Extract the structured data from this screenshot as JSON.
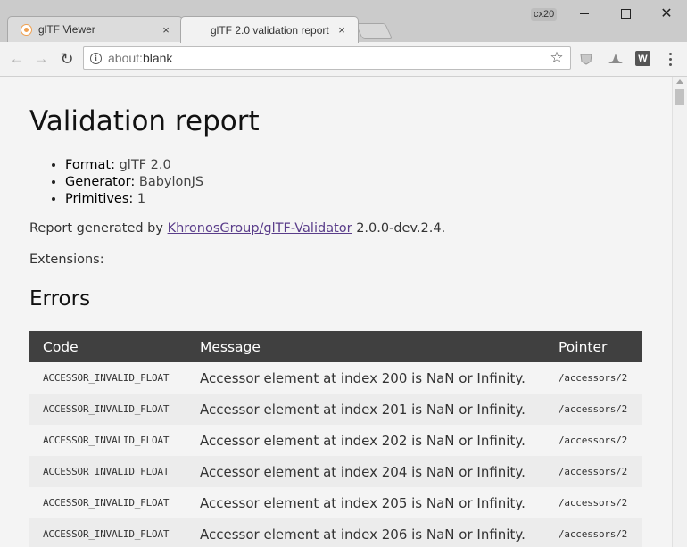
{
  "window": {
    "label": "cx20",
    "minimize_label": "—",
    "maximize_label": "☐",
    "close_label": "✕"
  },
  "tabs": [
    {
      "title": "glTF Viewer",
      "close": "×"
    },
    {
      "title": "glTF 2.0 validation report",
      "close": "×"
    }
  ],
  "toolbar": {
    "back": "←",
    "forward": "→",
    "reload": "↻",
    "url_prefix": "about:",
    "url_rest": "blank",
    "info_icon": "i",
    "star": "☆",
    "ext_w": "W"
  },
  "report": {
    "title": "Validation report",
    "meta": [
      {
        "key": "Format:",
        "value": "glTF 2.0"
      },
      {
        "key": "Generator:",
        "value": "BabylonJS"
      },
      {
        "key": "Primitives:",
        "value": "1"
      }
    ],
    "generated_prefix": "Report generated by ",
    "generated_link": "KhronosGroup/glTF-Validator",
    "generated_suffix": " 2.0.0-dev.2.4.",
    "extensions_label": "Extensions:",
    "errors_heading": "Errors",
    "columns": [
      "Code",
      "Message",
      "Pointer"
    ],
    "rows": [
      {
        "code": "ACCESSOR_INVALID_FLOAT",
        "message": "Accessor element at index 200 is NaN or Infinity.",
        "pointer": "/accessors/2"
      },
      {
        "code": "ACCESSOR_INVALID_FLOAT",
        "message": "Accessor element at index 201 is NaN or Infinity.",
        "pointer": "/accessors/2"
      },
      {
        "code": "ACCESSOR_INVALID_FLOAT",
        "message": "Accessor element at index 202 is NaN or Infinity.",
        "pointer": "/accessors/2"
      },
      {
        "code": "ACCESSOR_INVALID_FLOAT",
        "message": "Accessor element at index 204 is NaN or Infinity.",
        "pointer": "/accessors/2"
      },
      {
        "code": "ACCESSOR_INVALID_FLOAT",
        "message": "Accessor element at index 205 is NaN or Infinity.",
        "pointer": "/accessors/2"
      },
      {
        "code": "ACCESSOR_INVALID_FLOAT",
        "message": "Accessor element at index 206 is NaN or Infinity.",
        "pointer": "/accessors/2"
      }
    ]
  },
  "colors": {
    "header_bg": "#404040",
    "link": "#5a3d8a",
    "page_bg": "#f4f4f4"
  }
}
